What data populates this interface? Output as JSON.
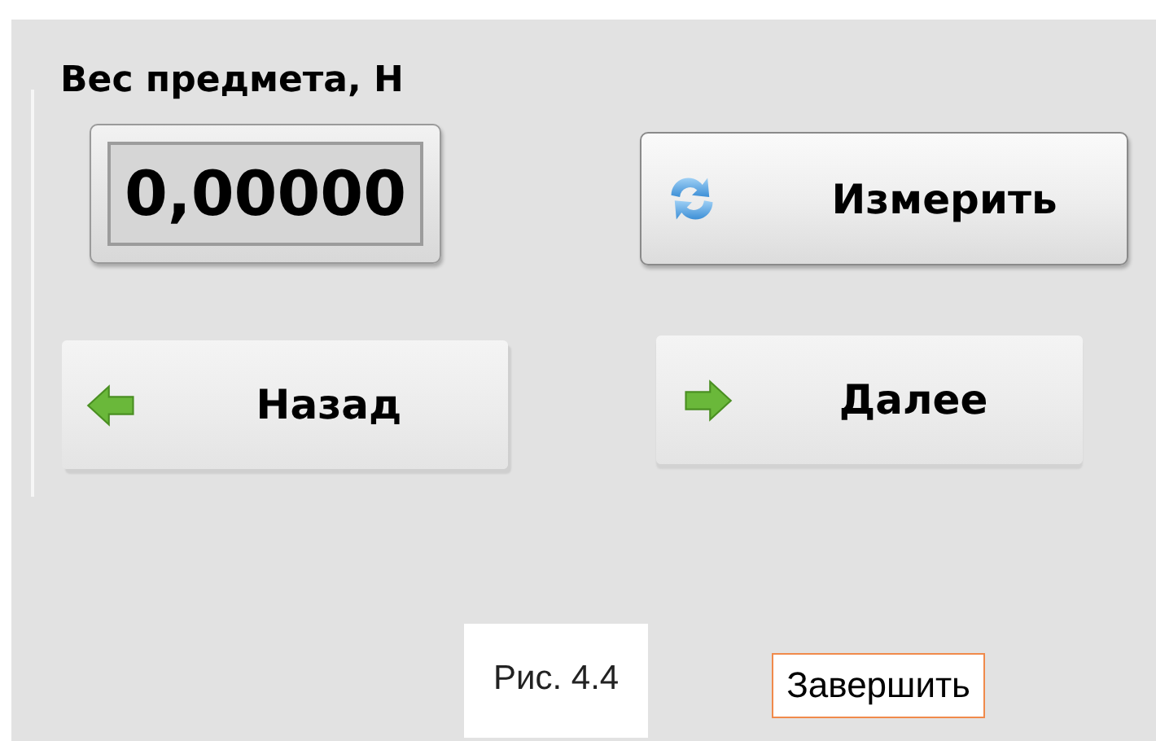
{
  "weight": {
    "label": "Вес предмета, Н",
    "value": "0,00000"
  },
  "buttons": [
    {
      "kind": "measure",
      "label": "Измерить"
    },
    {
      "kind": "back",
      "label": "Назад"
    },
    {
      "kind": "next",
      "label": "Далее"
    }
  ],
  "caption": "Рис. 4.4",
  "finish_button": {
    "label": "Завершить"
  }
}
